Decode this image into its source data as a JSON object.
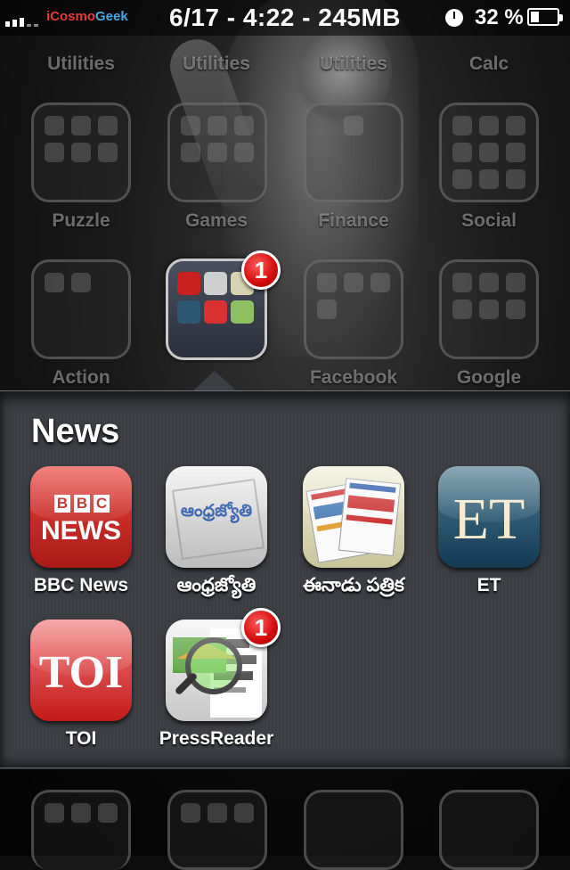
{
  "status_bar": {
    "carrier_part1": "iCosmo",
    "carrier_part2": "Geek",
    "center_text": "6/17 - 4:22 - 245MB",
    "battery_percent": "32 %",
    "battery_level": 0.32,
    "icons": [
      "signal-bars-icon",
      "clock-icon",
      "battery-icon"
    ]
  },
  "home": {
    "row1_labels": [
      "Utilities",
      "Utilities",
      "Utilities",
      "Calc"
    ],
    "row2_labels": [
      "Puzzle",
      "Games",
      "Finance",
      "Social"
    ],
    "row3_labels": [
      "Action",
      "",
      "Facebook",
      "Google"
    ]
  },
  "active_folder": {
    "badge": "1"
  },
  "news_folder": {
    "title": "News",
    "apps": [
      {
        "label": "BBC News",
        "icon_text_1": "B",
        "icon_text_2": "B",
        "icon_text_3": "C",
        "icon_text_4": "NEWS"
      },
      {
        "label": "ఆంధ్రజ్యోతి",
        "icon_text": "ఆంధ్రజ్యోతి"
      },
      {
        "label": "ఈనాడు పత్రిక"
      },
      {
        "label": "ET",
        "icon_text": "ET"
      },
      {
        "label": "TOI",
        "icon_text": "TOI"
      },
      {
        "label": "PressReader",
        "badge": "1"
      }
    ]
  }
}
